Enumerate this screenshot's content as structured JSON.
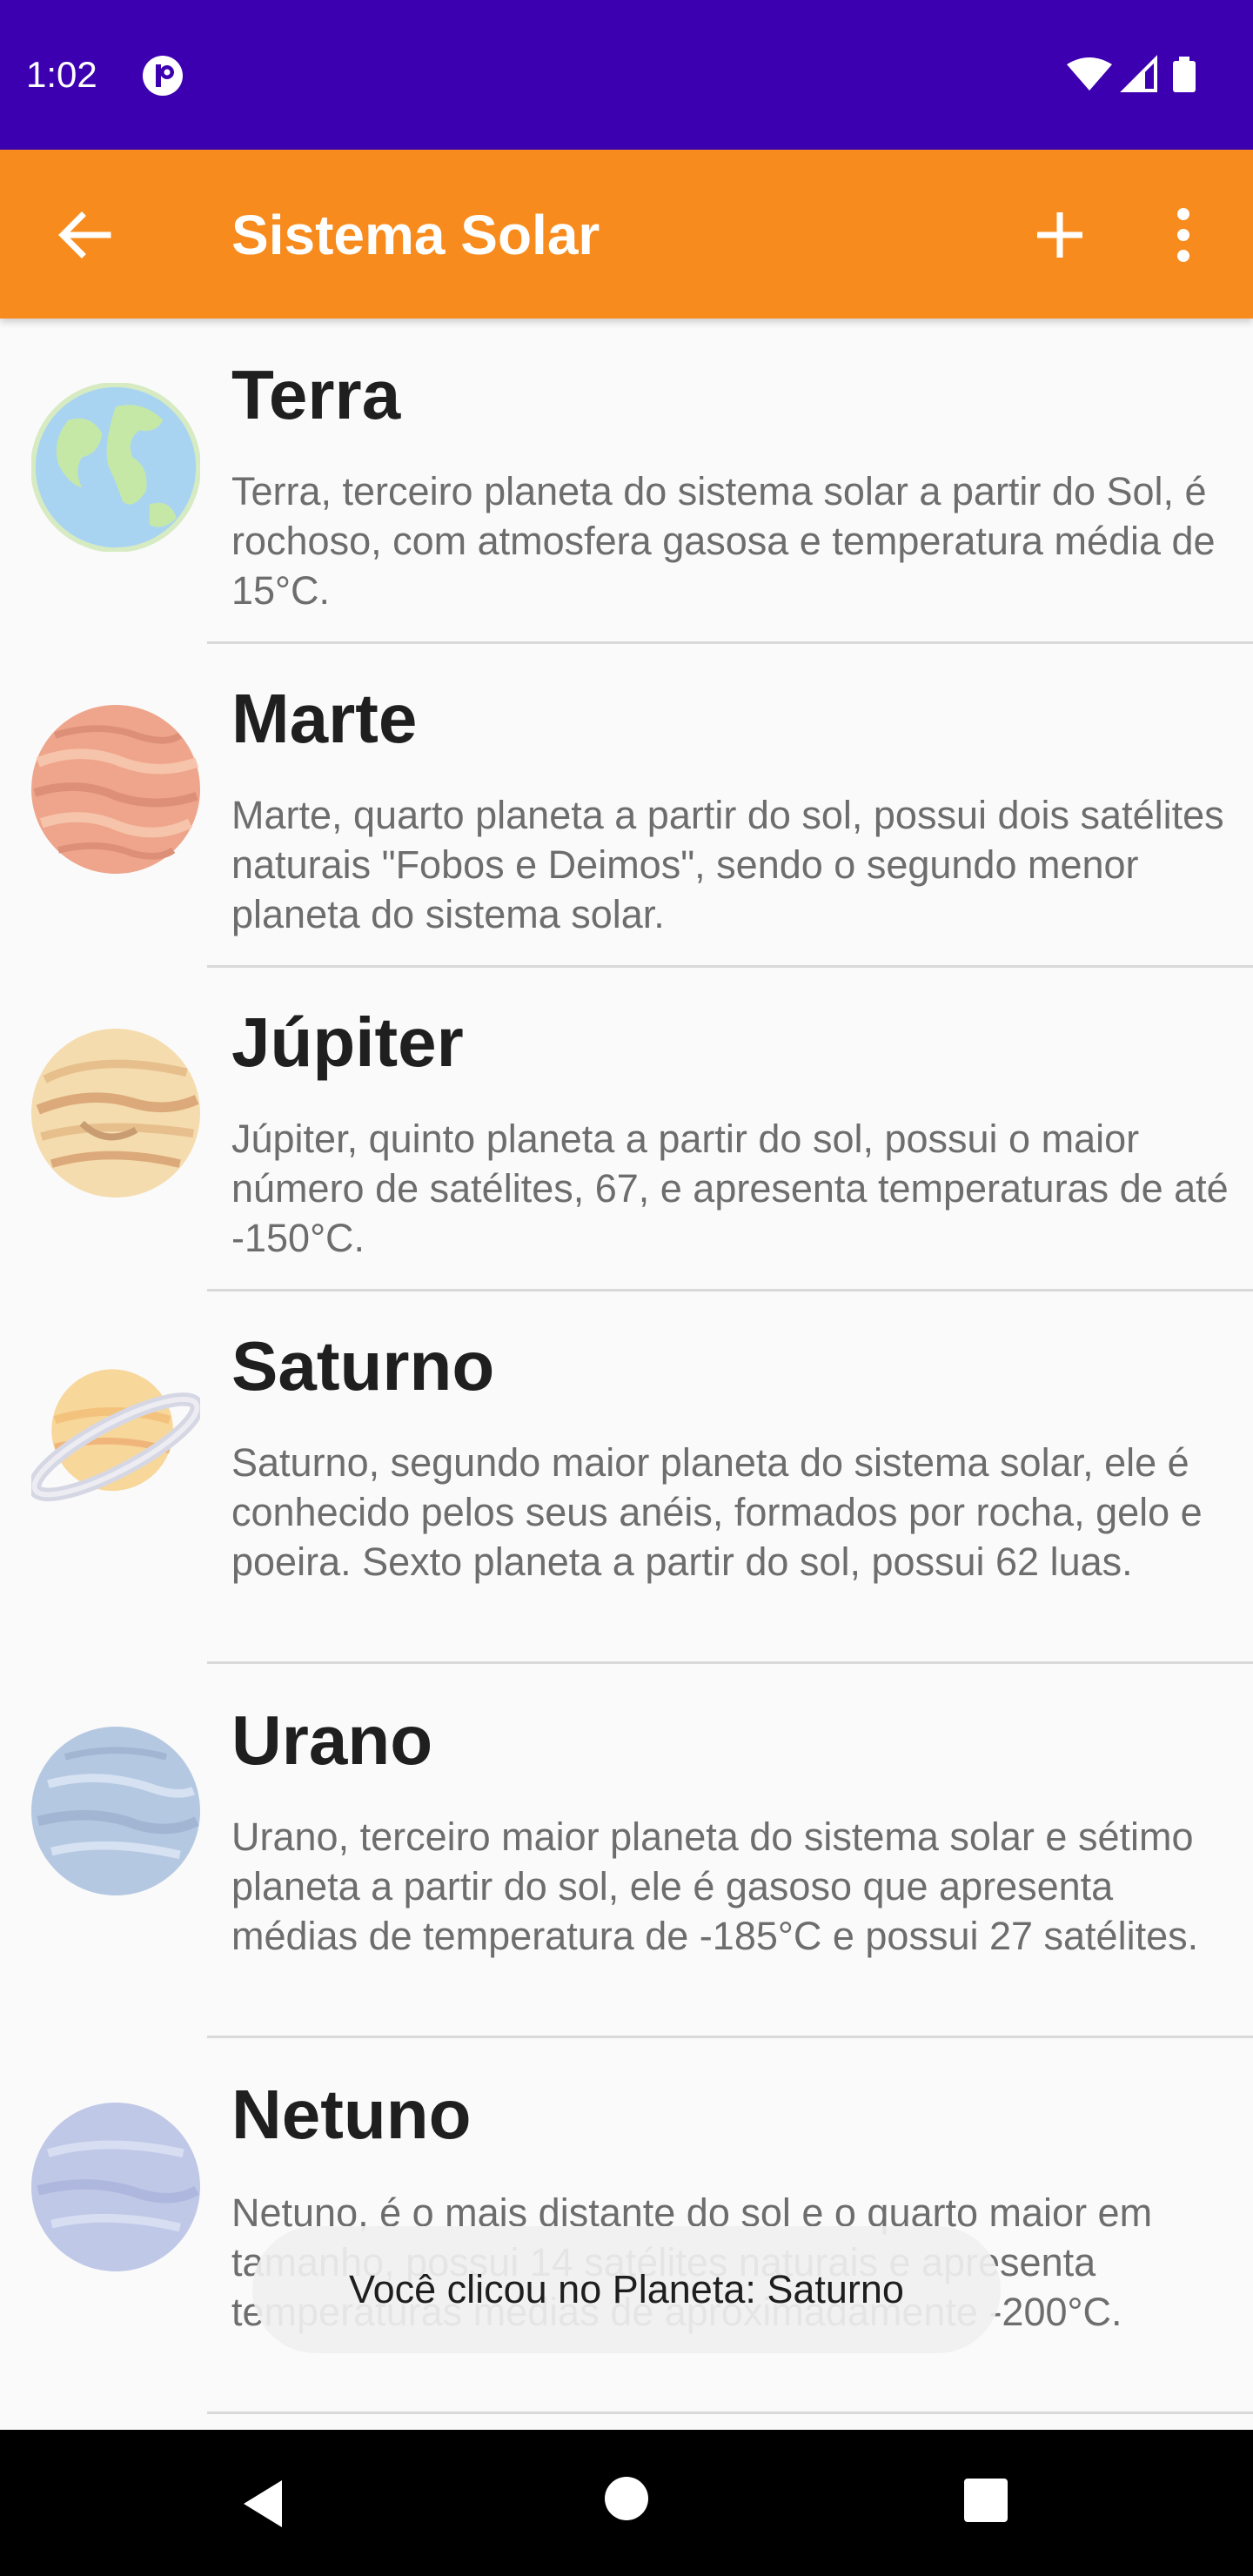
{
  "status_bar": {
    "time": "1:02"
  },
  "app_bar": {
    "title": "Sistema Solar",
    "back_icon": "arrow-left-icon",
    "add_icon": "plus-icon",
    "menu_icon": "more-vertical-icon"
  },
  "planets": [
    {
      "name": "Terra",
      "description": "Terra, terceiro planeta do sistema solar a partir do Sol, é rochoso, com atmosfera gasosa e temperatura média de 15°C.",
      "icon": "earth-icon"
    },
    {
      "name": "Marte",
      "description": "Marte, quarto planeta a partir do sol, possui dois satélites naturais \"Fobos e Deimos\", sendo o segundo menor planeta do sistema solar.",
      "icon": "mars-icon"
    },
    {
      "name": "Júpiter",
      "description": "Júpiter, quinto planeta a partir do sol, possui o maior número de satélites, 67, e apresenta temperaturas de até -150°C.",
      "icon": "jupiter-icon"
    },
    {
      "name": "Saturno",
      "description": "Saturno, segundo maior planeta do sistema solar, ele é conhecido pelos seus anéis, formados por rocha, gelo e poeira. Sexto planeta a partir do sol, possui 62 luas.",
      "icon": "saturn-icon"
    },
    {
      "name": "Urano",
      "description": "Urano, terceiro maior planeta do sistema solar e sétimo planeta a partir do sol, ele é gasoso que apresenta médias de temperatura de -185°C e possui 27 satélites.",
      "icon": "uranus-icon"
    },
    {
      "name": "Netuno",
      "description": "Netuno, é o mais distante do sol e o quarto maior em tamanho, possui 14 satélites naturais e apresenta temperaturas médias de aproximadamente -200°C.",
      "icon": "neptune-icon"
    }
  ],
  "toast": {
    "message": "Você clicou no Planeta: Saturno"
  },
  "colors": {
    "status_bar": "#3d00b0",
    "app_bar": "#f88b1d",
    "background": "#fafafa"
  }
}
